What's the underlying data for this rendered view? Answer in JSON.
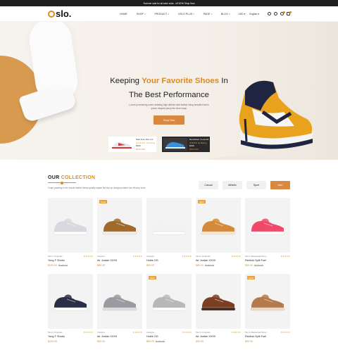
{
  "topbar": {
    "text": "Summer sale for all swim suits - off 30%! Shop Now"
  },
  "header": {
    "logo": "slo.",
    "nav": [
      "HOME",
      "SHOP",
      "PRODUCT",
      "OSLO PLUS",
      "PAGE",
      "BLOG"
    ],
    "currency": "USD",
    "language": "English"
  },
  "hero": {
    "line1_pre": "Keeping ",
    "line1_accent": "Your Favorite Shoes",
    "line1_post": " In",
    "line2": "The Best Performance",
    "subtitle": "Lorem ip lestening lorem detailing high athletic heel leather lining beautiful lorem ipsum elegant yeezy tee shoe wrap.",
    "button": "Shop Now",
    "mini1": {
      "name": "Nike Free Run 2.0",
      "rating": "★★★★★ 10 Rating",
      "price": "$300",
      "old": "$520 5lbs"
    },
    "mini2": {
      "name": "Revolution 4 Low Fit",
      "rating": "★★★★ 14 Rating",
      "price": "$299",
      "old": "$400 5lbs"
    }
  },
  "collection": {
    "title_a": "OUR ",
    "title_b": "COLLECTION",
    "desc": "Foam padding in the insole leather finest quality staple flat slip-on design pointed toe off-duty shoe",
    "filters": [
      "Casual",
      "Athletic",
      "Sport",
      "Man"
    ]
  },
  "products_row1": [
    {
      "cat": "Men's Originals",
      "name": "Yong F Shoes",
      "price": "$100.00",
      "old": "$140.00",
      "tag": "",
      "color": "#d8d8de",
      "sole": "#fff"
    },
    {
      "cat": "Classics",
      "name": "Air Jordan XXXII",
      "price": "$60.00",
      "old": "",
      "tag": "SALE",
      "color": "#a06a2c",
      "sole": "#eee"
    },
    {
      "cat": "Lifestyle",
      "name": "Hobis OG",
      "price": "$80.00",
      "old": "",
      "tag": "",
      "color": "#f2f2f4",
      "sole": "#fff"
    },
    {
      "cat": "Men's Originals",
      "name": "Air Jordan XXXII",
      "price": "$80.00",
      "old": "$100.00",
      "tag": "NEW",
      "color": "#d48a3a",
      "sole": "#f6e7cf"
    },
    {
      "cat": "Men's Basketball Shoe",
      "name": "Reebok Split Fuel",
      "price": "$90.00",
      "old": "$130.00",
      "tag": "",
      "color": "#f04a6a",
      "sole": "#fff"
    }
  ],
  "products_row2": [
    {
      "cat": "Men's Originals",
      "name": "Yong F Shoes",
      "price": "$100.00",
      "old": "",
      "tag": "",
      "color": "#2a2f45",
      "sole": "#fff"
    },
    {
      "cat": "Classics",
      "name": "Air Jordan XXXII",
      "price": "$60.00",
      "old": "",
      "tag": "",
      "color": "#9a9aa0",
      "sole": "#ddd"
    },
    {
      "cat": "Lifestyle",
      "name": "Hobis OG",
      "price": "$80.00",
      "old": "$140.00",
      "tag": "NEW",
      "color": "#b8b8b8",
      "sole": "#fff"
    },
    {
      "cat": "Men's Originals",
      "name": "Air Jordan XXXII",
      "price": "$90.00",
      "old": "",
      "tag": "",
      "color": "#7a3e22",
      "sole": "#3a2a20"
    },
    {
      "cat": "Men's Basketball Shoe",
      "name": "Reebok Split Fuel",
      "price": "$90.00",
      "old": "",
      "tag": "SALE",
      "color": "#b47a4c",
      "sole": "#ead9c4"
    }
  ],
  "colors": {
    "accent": "#e08a1e",
    "button": "#d8893f"
  }
}
